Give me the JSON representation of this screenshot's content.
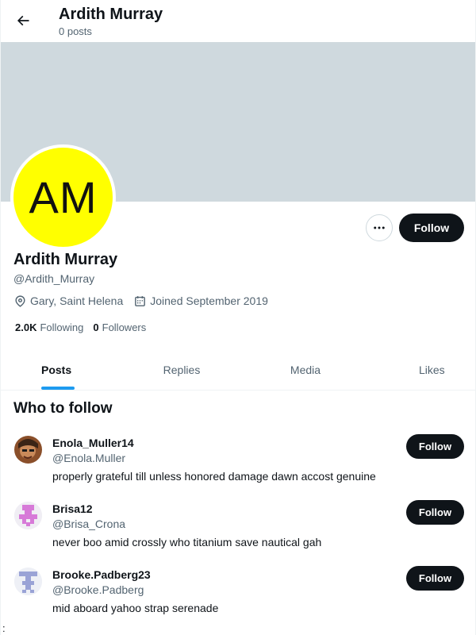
{
  "header": {
    "title": "Ardith Murray",
    "subtitle": "0 posts",
    "back_icon": "arrow-left-icon"
  },
  "colors": {
    "banner": "#cfd9de",
    "avatar_bg": "#ffff00",
    "accent": "#1d9bf0",
    "button_dark": "#0f1419"
  },
  "profile": {
    "avatar_initials": "AM",
    "name": "Ardith Murray",
    "handle": "@Ardith_Murray",
    "location": "Gary, Saint Helena",
    "joined": "Joined September 2019",
    "following_count": "2.0K",
    "following_label": "Following",
    "followers_count": "0",
    "followers_label": "Followers",
    "follow_label": "Follow",
    "more_icon": "more-horizontal-icon"
  },
  "tabs": [
    {
      "label": "Posts",
      "active": true
    },
    {
      "label": "Replies",
      "active": false
    },
    {
      "label": "Media",
      "active": false
    },
    {
      "label": "Likes",
      "active": false
    }
  ],
  "who_to_follow": {
    "title": "Who to follow",
    "items": [
      {
        "name": "Enola_Muller14",
        "handle": "@Enola.Muller",
        "bio": "properly grateful till unless honored damage dawn accost genuine",
        "follow_label": "Follow"
      },
      {
        "name": "Brisa12",
        "handle": "@Brisa_Crona",
        "bio": "never boo amid crossly who titanium save nautical gah",
        "follow_label": "Follow"
      },
      {
        "name": "Brooke.Padberg23",
        "handle": "@Brooke.Padberg",
        "bio": "mid aboard yahoo strap serenade",
        "follow_label": "Follow"
      }
    ]
  },
  "footer_mark": ":"
}
